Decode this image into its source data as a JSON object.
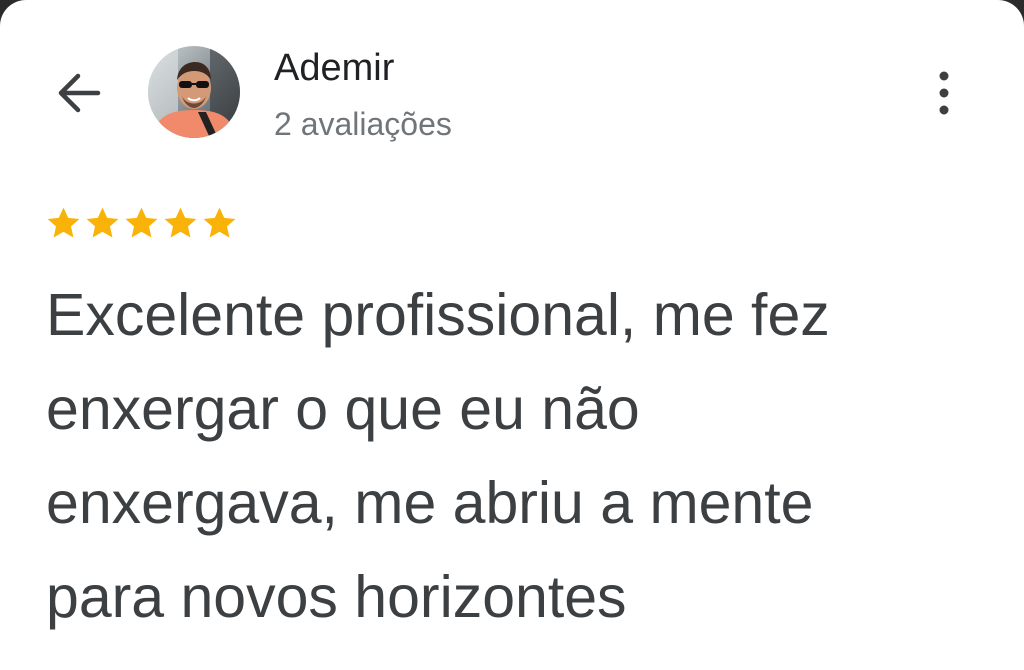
{
  "header": {
    "author_name": "Ademir",
    "review_count": "2 avaliações"
  },
  "icons": {
    "back": "arrow-left-icon",
    "more": "more-vert-icon",
    "star": "star-icon"
  },
  "review": {
    "rating": 5,
    "max_rating": 5,
    "lines": [
      "Excelente profissional, me fez",
      "enxergar o que eu não",
      "enxergava, me abriu a mente",
      "para novos horizontes"
    ]
  },
  "colors": {
    "star": "#f9b208",
    "name": "#202124",
    "secondary": "#70757a",
    "body_text": "#3c4043"
  }
}
